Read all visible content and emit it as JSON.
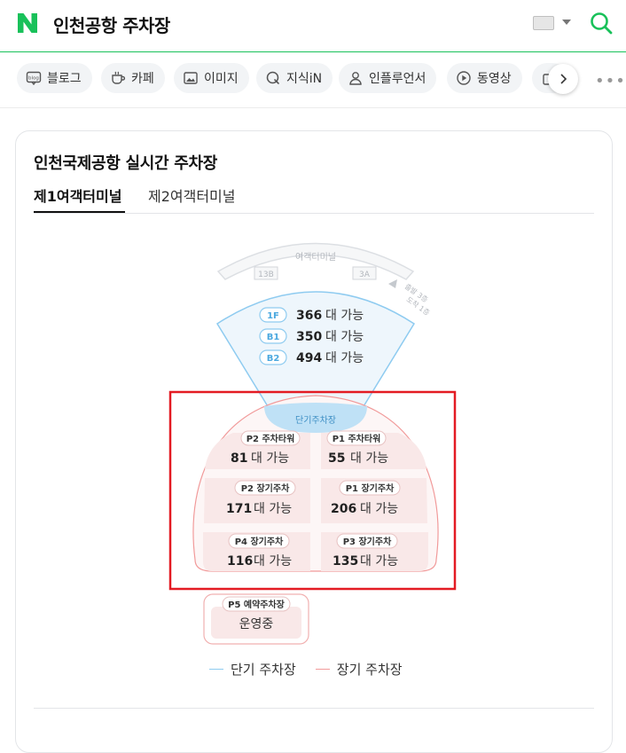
{
  "header": {
    "logo_letter": "N",
    "query": "인천공항 주차장"
  },
  "tabs": [
    {
      "label": "블로그",
      "icon": "blog-icon"
    },
    {
      "label": "카페",
      "icon": "cafe-icon"
    },
    {
      "label": "이미지",
      "icon": "image-icon"
    },
    {
      "label": "지식iN",
      "icon": "kin-icon"
    },
    {
      "label": "인플루언서",
      "icon": "influencer-icon"
    },
    {
      "label": "동영상",
      "icon": "video-icon"
    }
  ],
  "colors": {
    "naver_green": "#19c15a",
    "short_term_blue": "#8ecbf0",
    "long_term_red": "#f19a9a",
    "highlight_red": "#e31b23"
  },
  "card": {
    "title": "인천국제공항 실시간 주차장",
    "subtabs": [
      "제1여객터미널",
      "제2여객터미널"
    ],
    "active_subtab": "제1여객터미널"
  },
  "map": {
    "terminal_label": "여객터미널",
    "gate_left": "13B",
    "gate_right": "3A",
    "departure_note_1": "출발 3층",
    "departure_note_2": "도착 1층",
    "short_term_label": "단기주차장",
    "unit_suffix": "대 가능",
    "short_term_floors": [
      {
        "floor": "1F",
        "count": "366"
      },
      {
        "floor": "B1",
        "count": "350"
      },
      {
        "floor": "B2",
        "count": "494"
      }
    ],
    "lots": [
      {
        "id": "p2-tower",
        "name": "P2 주차타워",
        "count": "81"
      },
      {
        "id": "p1-tower",
        "name": "P1 주차타워",
        "count": "55"
      },
      {
        "id": "p2-long",
        "name": "P2 장기주차",
        "count": "171"
      },
      {
        "id": "p1-long",
        "name": "P1 장기주차",
        "count": "206"
      },
      {
        "id": "p4-long",
        "name": "P4 장기주차",
        "count": "116"
      },
      {
        "id": "p3-long",
        "name": "P3 장기주차",
        "count": "135"
      }
    ],
    "p5": {
      "name": "P5 예약주차장",
      "status": "운영중"
    }
  },
  "legend": {
    "short": "단기 주차장",
    "long": "장기 주차장"
  }
}
